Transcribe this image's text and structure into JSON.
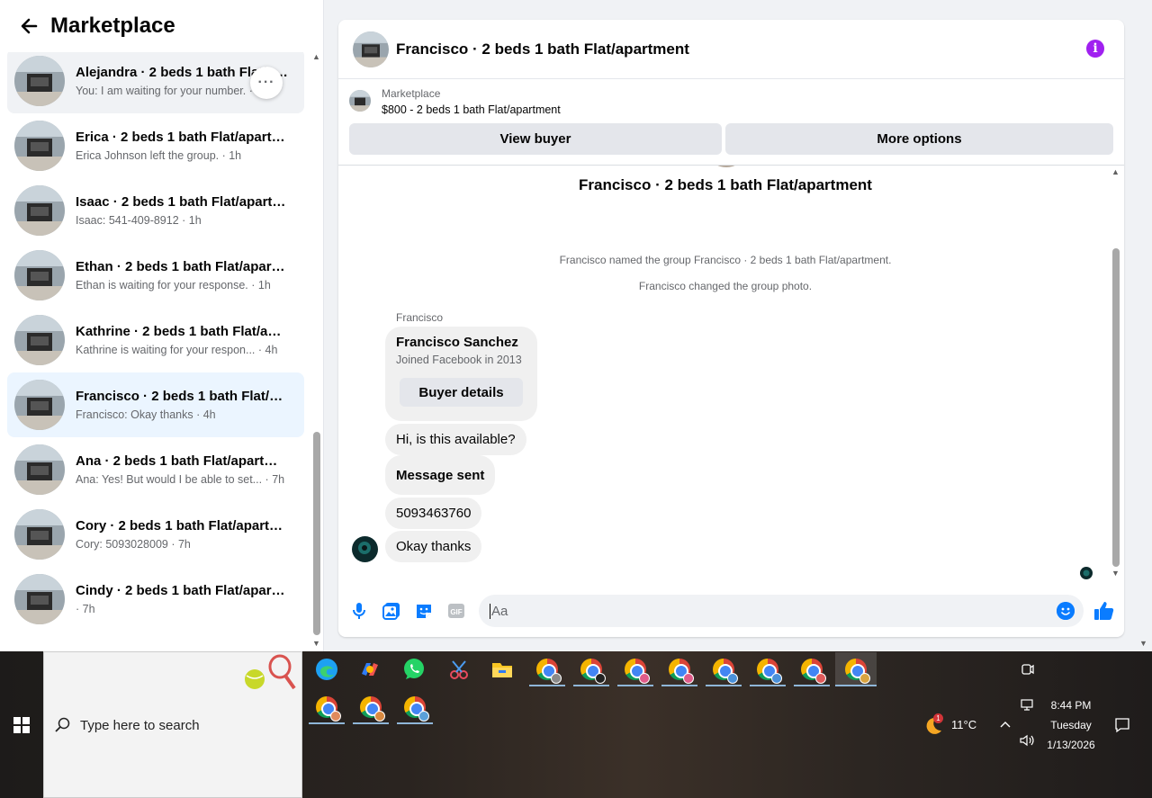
{
  "sidebar": {
    "title": "Marketplace",
    "conversations": [
      {
        "name": "",
        "sub": ""
      },
      {
        "name": "Alejandra · 2 beds 1 bath Flat/apartment",
        "sub": "You: I am waiting for your number. · 1h"
      },
      {
        "name": "Erica · 2 beds 1 bath Flat/apartment",
        "sub": "Erica Johnson left the group. · 1h"
      },
      {
        "name": "Isaac · 2 beds 1 bath Flat/apartment",
        "sub": "Isaac: 541-409-8912 · 1h"
      },
      {
        "name": "Ethan · 2 beds 1 bath Flat/apartment",
        "sub": "Ethan is waiting for your response. · 1h"
      },
      {
        "name": "Kathrine · 2 beds 1 bath Flat/apartment",
        "sub": "Kathrine is waiting for your respon... · 4h"
      },
      {
        "name": "Francisco · 2 beds 1 bath Flat/apartment",
        "sub": "Francisco: Okay thanks · 4h"
      },
      {
        "name": "Ana · 2 beds 1 bath Flat/apartment",
        "sub": "Ana: Yes! But would I be able to set... · 7h"
      },
      {
        "name": "Cory · 2 beds 1 bath Flat/apartment",
        "sub": "Cory: 5093028009 · 7h"
      },
      {
        "name": "Cindy · 2 beds 1 bath Flat/apartment",
        "sub": " · 7h"
      }
    ],
    "more_label": "···"
  },
  "chat": {
    "title": "Francisco · 2 beds 1 bath Flat/apartment",
    "info_label": "i",
    "listing": {
      "source": "Marketplace",
      "price_title": "$800 - 2 beds 1 bath Flat/apartment",
      "view_buyer": "View buyer",
      "more_options": "More options"
    },
    "group_title": "Francisco · 2 beds 1 bath Flat/apartment",
    "system_messages": [
      "Francisco named the group Francisco · 2 beds 1 bath Flat/apartment.",
      "Francisco changed the group photo."
    ],
    "sender": "Francisco",
    "card": {
      "name": "Francisco Sanchez",
      "sub": "Joined Facebook in 2013",
      "button": "Buyer details"
    },
    "messages": [
      "Hi, is this available?",
      "Message sent",
      "5093463760",
      "Okay thanks"
    ],
    "composer": {
      "placeholder": "Aa"
    }
  },
  "taskbar": {
    "search_placeholder": "Type here to search",
    "weather": "11°C",
    "weather_badge": "1",
    "time": "8:44 PM",
    "day": "Tuesday",
    "date": "1/13/2026"
  },
  "colors": {
    "accent": "#0a7cff",
    "info": "#a020f0",
    "active_row": "#ebf5ff"
  }
}
